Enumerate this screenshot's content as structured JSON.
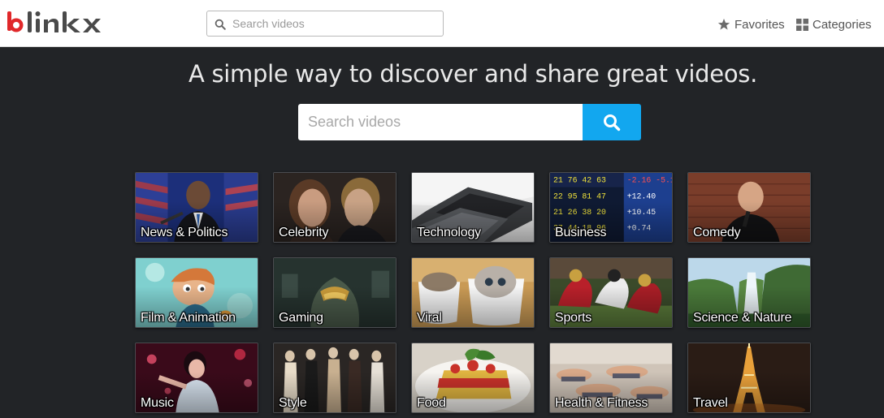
{
  "header": {
    "logo_text": "blinkx",
    "search": {
      "placeholder": "Search videos",
      "value": ""
    },
    "favorites_label": "Favorites",
    "categories_label": "Categories"
  },
  "hero": {
    "headline": "A simple way to discover and share great videos.",
    "search": {
      "placeholder": "Search videos",
      "value": ""
    }
  },
  "colors": {
    "accent_blue": "#12a7ef",
    "logo_red": "#e0282a",
    "logo_dark": "#4a4a4a",
    "page_background": "#222427"
  },
  "icons": {
    "header_search": "search-icon",
    "favorites": "star-icon",
    "categories": "grid-icon",
    "hero_search": "search-icon"
  },
  "categories": [
    {
      "label": "News & Politics"
    },
    {
      "label": "Celebrity"
    },
    {
      "label": "Technology"
    },
    {
      "label": "Business"
    },
    {
      "label": "Comedy"
    },
    {
      "label": "Film & Animation"
    },
    {
      "label": "Gaming"
    },
    {
      "label": "Viral"
    },
    {
      "label": "Sports"
    },
    {
      "label": "Science & Nature"
    },
    {
      "label": "Music"
    },
    {
      "label": "Style"
    },
    {
      "label": "Food"
    },
    {
      "label": "Health & Fitness"
    },
    {
      "label": "Travel"
    }
  ]
}
